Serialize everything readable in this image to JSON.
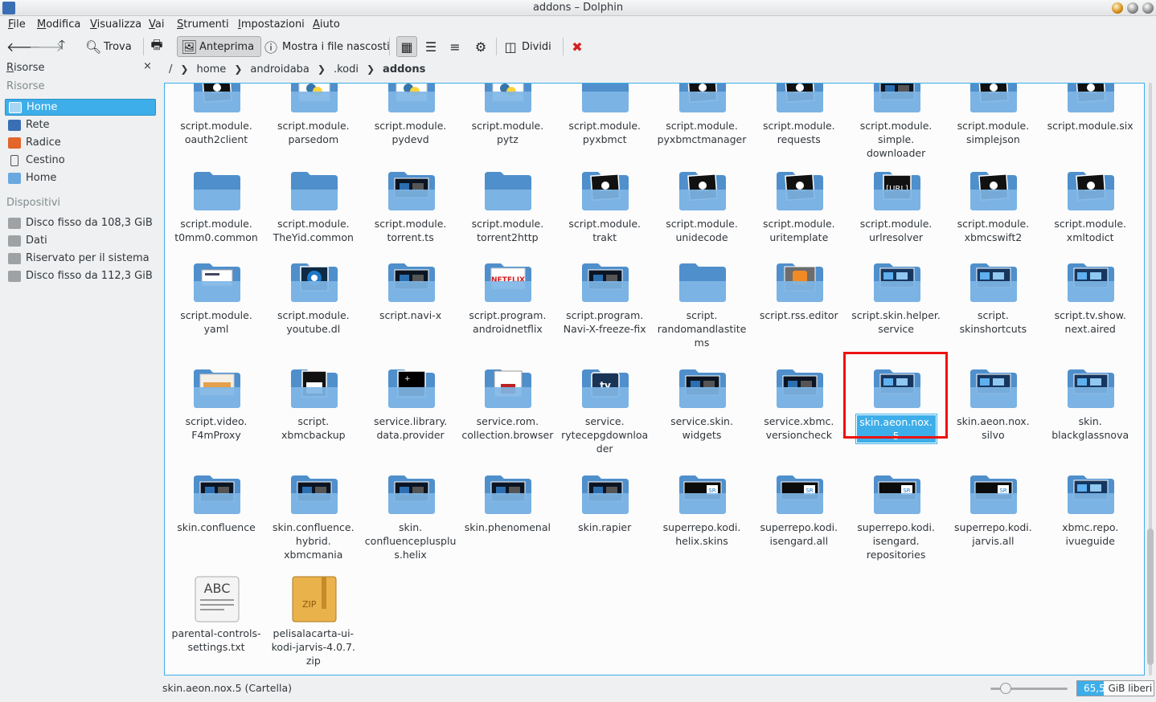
{
  "window": {
    "title": "addons – Dolphin"
  },
  "menubar": [
    "File",
    "Modifica",
    "Visualizza",
    "Vai",
    "Strumenti",
    "Impostazioni",
    "Aiuto"
  ],
  "toolbar": {
    "find_label": "Trova",
    "preview_label": "Anteprima",
    "hidden_label": "Mostra i file nascosti",
    "split_label": "Dividi"
  },
  "sidebar": {
    "title": "Risorse",
    "close_glyph": "×",
    "places_header": "Risorse",
    "places": [
      {
        "label": "Home",
        "selected": true,
        "icon": "home-icon"
      },
      {
        "label": "Rete",
        "icon": "network-icon"
      },
      {
        "label": "Radice",
        "icon": "root-folder-icon"
      },
      {
        "label": "Cestino",
        "icon": "trash-icon"
      },
      {
        "label": "Home",
        "icon": "home-icon"
      }
    ],
    "devices_header": "Dispositivi",
    "devices": [
      {
        "label": "Disco fisso da 108,3 GiB",
        "icon": "harddisk-icon"
      },
      {
        "label": "Dati",
        "icon": "harddisk-icon"
      },
      {
        "label": "Riservato per il sistema",
        "icon": "harddisk-icon"
      },
      {
        "label": "Disco fisso da 112,3 GiB",
        "icon": "harddisk-icon"
      }
    ]
  },
  "breadcrumb": {
    "root": "/",
    "parts": [
      "home",
      "androidaba",
      ".kodi"
    ],
    "current": "addons"
  },
  "files": [
    {
      "name": "script.module.\noauth2client",
      "kind": "folder-python"
    },
    {
      "name": "script.module.\nparsedom",
      "kind": "folder-py-yellow"
    },
    {
      "name": "script.module.\npydevd",
      "kind": "folder-py-yellow"
    },
    {
      "name": "script.module.\npytz",
      "kind": "folder-py-yellow"
    },
    {
      "name": "script.module.\npyxbmct",
      "kind": "folder-plain"
    },
    {
      "name": "script.module.\npyxbmctmanager",
      "kind": "folder-python"
    },
    {
      "name": "script.module.\nrequests",
      "kind": "folder-python"
    },
    {
      "name": "script.module.\nsimple.\ndownloader",
      "kind": "folder-dark"
    },
    {
      "name": "script.module.\nsimplejson",
      "kind": "folder-python"
    },
    {
      "name": "script.module.six",
      "kind": "folder-python"
    },
    {
      "name": "script.module.\nt0mm0.common",
      "kind": "folder-plain"
    },
    {
      "name": "script.module.\nTheYid.common",
      "kind": "folder-plain"
    },
    {
      "name": "script.module.\ntorrent.ts",
      "kind": "folder-dark"
    },
    {
      "name": "script.module.\ntorrent2http",
      "kind": "folder-plain"
    },
    {
      "name": "script.module.\ntrakt",
      "kind": "folder-python"
    },
    {
      "name": "script.module.\nunidecode",
      "kind": "folder-python"
    },
    {
      "name": "script.module.\nuritemplate",
      "kind": "folder-python"
    },
    {
      "name": "script.module.\nurlresolver",
      "kind": "folder-url"
    },
    {
      "name": "script.module.\nxbmcswift2",
      "kind": "folder-python"
    },
    {
      "name": "script.module.\nxmltodict",
      "kind": "folder-python"
    },
    {
      "name": "script.module.\nyaml",
      "kind": "folder-white"
    },
    {
      "name": "script.module.\nyoutube.dl",
      "kind": "folder-youtube"
    },
    {
      "name": "script.navi-x",
      "kind": "folder-dark"
    },
    {
      "name": "script.program.\nandroidnetflix",
      "kind": "folder-netflix"
    },
    {
      "name": "script.program.\nNavi-X-freeze-fix",
      "kind": "folder-dark"
    },
    {
      "name": "script.\nrandomandlastite\nms",
      "kind": "folder-plain"
    },
    {
      "name": "script.rss.editor",
      "kind": "folder-rss"
    },
    {
      "name": "script.skin.helper.\nservice",
      "kind": "folder-blue-dark"
    },
    {
      "name": "script.\nskinshortcuts",
      "kind": "folder-blue-dark"
    },
    {
      "name": "script.tv.show.\nnext.aired",
      "kind": "folder-blue-dark"
    },
    {
      "name": "script.video.\nF4mProxy",
      "kind": "folder-f4m"
    },
    {
      "name": "script.\nxbmcbackup",
      "kind": "folder-floppy"
    },
    {
      "name": "service.library.\ndata.provider",
      "kind": "folder-black"
    },
    {
      "name": "service.rom.\ncollection.browser",
      "kind": "folder-rom"
    },
    {
      "name": "service.\nrytecepgdownloa\nder",
      "kind": "folder-tv"
    },
    {
      "name": "service.skin.\nwidgets",
      "kind": "folder-dark"
    },
    {
      "name": "service.xbmc.\nversioncheck",
      "kind": "folder-dark"
    },
    {
      "name": "skin.aeon.nox.5",
      "kind": "folder-blue-dark",
      "selected": true
    },
    {
      "name": "skin.aeon.nox.\nsilvo",
      "kind": "folder-blue-dark"
    },
    {
      "name": "skin.\nblackglassnova",
      "kind": "folder-blue-dark"
    },
    {
      "name": "skin.confluence",
      "kind": "folder-dark"
    },
    {
      "name": "skin.confluence.\nhybrid.\nxbmcmania",
      "kind": "folder-dark"
    },
    {
      "name": "skin.\nconfluenceplusplu\ns.helix",
      "kind": "folder-dark"
    },
    {
      "name": "skin.phenomenal",
      "kind": "folder-dark"
    },
    {
      "name": "skin.rapier",
      "kind": "folder-dark"
    },
    {
      "name": "superrepo.kodi.\nhelix.skins",
      "kind": "folder-sr"
    },
    {
      "name": "superrepo.kodi.\nisengard.all",
      "kind": "folder-sr"
    },
    {
      "name": "superrepo.kodi.\nisengard.\nrepositories",
      "kind": "folder-sr"
    },
    {
      "name": "superrepo.kodi.\njarvis.all",
      "kind": "folder-sr"
    },
    {
      "name": "xbmc.repo.\nivueguide",
      "kind": "folder-blue-dark"
    },
    {
      "name": "parental-controls-\nsettings.txt",
      "kind": "file-txt",
      "icon_text": "ABC"
    },
    {
      "name": "pelisalacarta-ui-\nkodi-jarvis-4.0.7.\nzip",
      "kind": "file-zip",
      "icon_text": "ZIP"
    }
  ],
  "statusbar": {
    "text": "skin.aeon.nox.5 (Cartella)",
    "free_value": "65,5",
    "free_unit": "GiB liberi",
    "zoom_level": 0.2,
    "used_fraction": 0.35
  },
  "colors": {
    "accent": "#3daee9",
    "highlight_box": "#ee1111",
    "folder": "#6aa9df"
  }
}
